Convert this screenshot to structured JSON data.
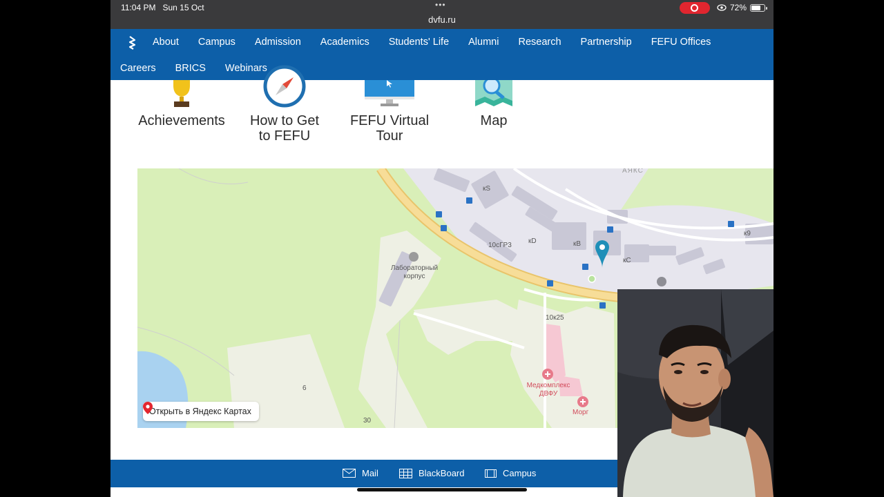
{
  "status_bar": {
    "time": "11:04 PM",
    "date": "Sun 15 Oct",
    "url": "dvfu.ru",
    "battery": "72%"
  },
  "nav": {
    "row1": [
      "About",
      "Campus",
      "Admission",
      "Academics",
      "Students' Life",
      "Alumni",
      "Research",
      "Partnership",
      "FEFU Offices"
    ],
    "row2": [
      "Careers",
      "BRICS",
      "Webinars"
    ]
  },
  "quick_links": {
    "achievements": "Achievements",
    "how_to_get_1": "How to Get",
    "how_to_get_2": "to FEFU",
    "virtual_tour_1": "FEFU Virtual",
    "virtual_tour_2": "Tour",
    "map": "Map"
  },
  "map": {
    "labels": {
      "ayaks": "АЯКС",
      "ks": "кS",
      "k9": "к9",
      "kd": "кD",
      "kb": "кB",
      "kc": "кC",
      "b10gr3": "10сГР3",
      "lab1": "Лабораторный",
      "lab2": "корпус",
      "b10k25": "10к25",
      "med1": "Медкомплекс",
      "med2": "ДВФУ",
      "morg": "Морг",
      "n6": "6",
      "n30": "30"
    },
    "open_button": "Открыть в Яндекс Картах"
  },
  "footer": {
    "mail": "Mail",
    "blackboard": "BlackBoard",
    "campus": "Campus"
  },
  "colors": {
    "brand_blue": "#0d5fa8",
    "map_green": "#d9efb8",
    "road_yellow": "#f3d58b"
  }
}
